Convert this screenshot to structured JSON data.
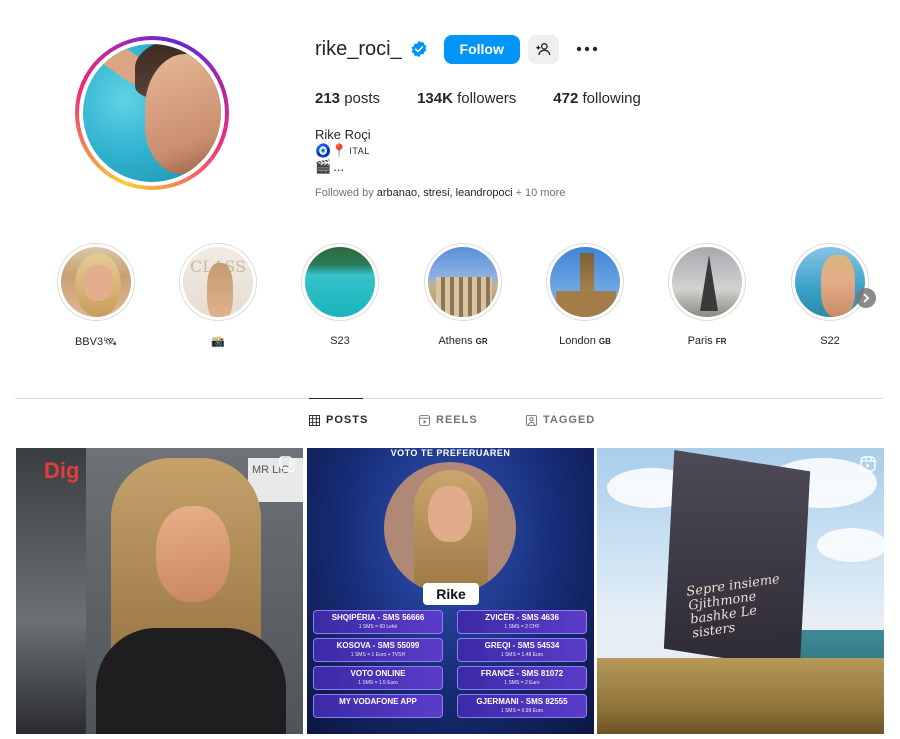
{
  "profile": {
    "username": "rike_roci_",
    "follow_label": "Follow",
    "stats": {
      "posts_count": "213",
      "posts_label": "posts",
      "followers_count": "134K",
      "followers_label": "followers",
      "following_count": "472",
      "following_label": "following"
    },
    "bio": {
      "name": "Rike Roçi",
      "line1_icons": "🧿📍",
      "line1_text": "ITAL",
      "line2_icon": "🎬",
      "line2_text": "..."
    },
    "followed_by": {
      "prefix": "Followed by ",
      "names": "arbanao, stresi, leandropoci",
      "suffix": " + 10 more"
    }
  },
  "highlights": [
    {
      "label": "BBV3",
      "flag": "",
      "emoji": "🛰"
    },
    {
      "label": "",
      "flag": "",
      "emoji": "📸"
    },
    {
      "label": "S23",
      "flag": "",
      "emoji": ""
    },
    {
      "label": "Athens",
      "flag": "GR",
      "emoji": ""
    },
    {
      "label": "London",
      "flag": "GB",
      "emoji": ""
    },
    {
      "label": "Paris",
      "flag": "FR",
      "emoji": ""
    },
    {
      "label": "S22",
      "flag": "",
      "emoji": ""
    }
  ],
  "tabs": {
    "posts": "POSTS",
    "reels": "REELS",
    "tagged": "TAGGED"
  },
  "posts": {
    "p1": {
      "logo": "Dig",
      "sign": "MR LIC"
    },
    "p2": {
      "title": "VOTO TE PREFERUAREN",
      "name": "Rike",
      "options": [
        {
          "main": "SHQIPËRIA - SMS 56666",
          "sub": "1 SMS = 60 Lekë"
        },
        {
          "main": "ZVICËR - SMS 4636",
          "sub": "1 SMS = 2 CHF"
        },
        {
          "main": "KOSOVA - SMS 55099",
          "sub": "1 SMS = 1 Euro + TVSH"
        },
        {
          "main": "GREQI - SMS 54534",
          "sub": "1 SMS = 1.48 Euro"
        },
        {
          "main": "VOTO ONLINE",
          "sub": "1 SMS = 1.5 Euro"
        },
        {
          "main": "FRANCË - SMS 81072",
          "sub": "1 SMS = 2 Euro"
        },
        {
          "main": "MY VODAFONE APP",
          "sub": ""
        },
        {
          "main": "GJERMANI - SMS 82555",
          "sub": "1 SMS = 0.99 Euro"
        }
      ]
    },
    "p3": {
      "flag_text": "Sepre insieme Gjithmone bashke Le sisters"
    }
  },
  "colors": {
    "follow_button": "#0095f6",
    "verified_badge": "#0095f6",
    "divider": "#dbdbdb",
    "muted_text": "#737373"
  }
}
